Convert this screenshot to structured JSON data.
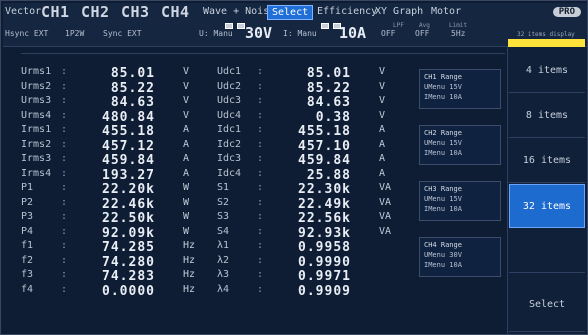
{
  "topbar": {
    "tabs": {
      "vector": "Vector",
      "ch1": "CH1",
      "ch2": "CH2",
      "ch3": "CH3",
      "ch4": "CH4",
      "wave_noise": "Wave + Noise",
      "select": "Select",
      "efficiency": "Efficiency",
      "xy_graph": "XY Graph",
      "motor": "Motor",
      "logo": "PRO"
    },
    "sub": {
      "hsync": "Hsync EXT",
      "update": "1P2W",
      "sync": "Sync EXT",
      "u_mode": "U: Manu",
      "u_range": "30V",
      "i_mode": "I: Manu",
      "i_range": "10A",
      "lpf_label": "LPF",
      "lpf_val": "OFF",
      "avg_label": "Avg",
      "avg_val": "OFF",
      "limit_label": "Limit",
      "limit_val": "5Hz"
    }
  },
  "side": {
    "caption": "32 items display",
    "buttons": [
      "4 items",
      "8 items",
      "16 items",
      "32 items",
      "",
      "Select"
    ],
    "active_index": 3
  },
  "left_rows": [
    {
      "label": "Urms1",
      "value": "85.01",
      "unit": "V"
    },
    {
      "label": "Urms2",
      "value": "85.22",
      "unit": "V"
    },
    {
      "label": "Urms3",
      "value": "84.63",
      "unit": "V"
    },
    {
      "label": "Urms4",
      "value": "480.84",
      "unit": "V"
    },
    {
      "label": "Irms1",
      "value": "455.18",
      "unit": "A"
    },
    {
      "label": "Irms2",
      "value": "457.12",
      "unit": "A"
    },
    {
      "label": "Irms3",
      "value": "459.84",
      "unit": "A"
    },
    {
      "label": "Irms4",
      "value": "193.27",
      "unit": "A"
    },
    {
      "label": "P1",
      "value": "22.20k",
      "unit": "W"
    },
    {
      "label": "P2",
      "value": "22.46k",
      "unit": "W"
    },
    {
      "label": "P3",
      "value": "22.50k",
      "unit": "W"
    },
    {
      "label": "P4",
      "value": "92.09k",
      "unit": "W"
    },
    {
      "label": "f1",
      "value": "74.285",
      "unit": "Hz"
    },
    {
      "label": "f2",
      "value": "74.280",
      "unit": "Hz"
    },
    {
      "label": "f3",
      "value": "74.283",
      "unit": "Hz"
    },
    {
      "label": "f4",
      "value": "0.0000",
      "unit": "Hz"
    }
  ],
  "right_rows": [
    {
      "label": "Udc1",
      "value": "85.01",
      "unit": "V"
    },
    {
      "label": "Udc2",
      "value": "85.22",
      "unit": "V"
    },
    {
      "label": "Udc3",
      "value": "84.63",
      "unit": "V"
    },
    {
      "label": "Udc4",
      "value": "0.38",
      "unit": "V"
    },
    {
      "label": "Idc1",
      "value": "455.18",
      "unit": "A"
    },
    {
      "label": "Idc2",
      "value": "457.10",
      "unit": "A"
    },
    {
      "label": "Idc3",
      "value": "459.84",
      "unit": "A"
    },
    {
      "label": "Idc4",
      "value": "25.88",
      "unit": "A"
    },
    {
      "label": "S1",
      "value": "22.30k",
      "unit": "VA"
    },
    {
      "label": "S2",
      "value": "22.49k",
      "unit": "VA"
    },
    {
      "label": "S3",
      "value": "22.56k",
      "unit": "VA"
    },
    {
      "label": "S4",
      "value": "92.93k",
      "unit": "VA"
    },
    {
      "label": "λ1",
      "value": "0.9958",
      "unit": ""
    },
    {
      "label": "λ2",
      "value": "0.9990",
      "unit": ""
    },
    {
      "label": "λ3",
      "value": "0.9971",
      "unit": ""
    },
    {
      "label": "λ4",
      "value": "0.9909",
      "unit": ""
    }
  ],
  "ranges": [
    {
      "title": "CH1  Range",
      "u": "UMenu  15V",
      "i": "IMenu  10A"
    },
    {
      "title": "CH2  Range",
      "u": "UMenu  15V",
      "i": "IMenu  10A"
    },
    {
      "title": "CH3  Range",
      "u": "UMenu  15V",
      "i": "IMenu  10A"
    },
    {
      "title": "CH4  Range",
      "u": "UMenu  30V",
      "i": "IMenu  10A"
    }
  ]
}
